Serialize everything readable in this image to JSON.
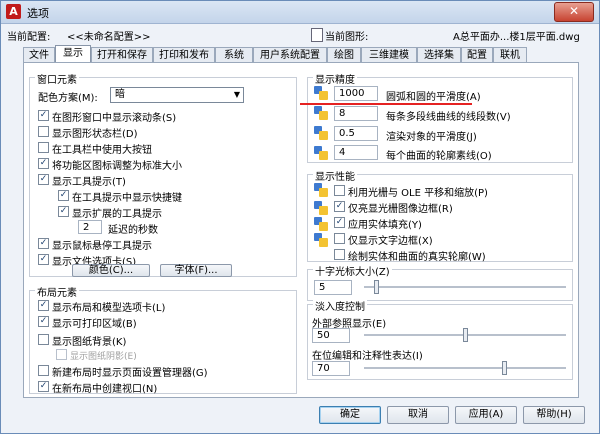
{
  "window": {
    "title": "选项",
    "close": "✕"
  },
  "config": {
    "current_config_label": "当前配置:",
    "current_config_value": "<<未命名配置>>",
    "current_drawing_label": "当前图形:",
    "current_drawing_value": "A总平面办...楼1层平面.dwg"
  },
  "tabs": [
    "文件",
    "显示",
    "打开和保存",
    "打印和发布",
    "系统",
    "用户系统配置",
    "绘图",
    "三维建模",
    "选择集",
    "配置",
    "联机"
  ],
  "active_tab": "显示",
  "window_elements": {
    "title": "窗口元素",
    "color_scheme_label": "配色方案(M):",
    "color_scheme_value": "暗",
    "items": [
      {
        "label": "在图形窗口中显示滚动条(S)",
        "checked": true
      },
      {
        "label": "显示图形状态栏(D)",
        "checked": false
      },
      {
        "label": "在工具栏中使用大按钮",
        "checked": false
      },
      {
        "label": "将功能区图标调整为标准大小",
        "checked": true
      },
      {
        "label": "显示工具提示(T)",
        "checked": true
      },
      {
        "label": "在工具提示中显示快捷键",
        "checked": true
      },
      {
        "label": "显示扩展的工具提示",
        "checked": true
      },
      {
        "label": "延迟的秒数",
        "value": "2"
      },
      {
        "label": "显示鼠标悬停工具提示",
        "checked": true
      },
      {
        "label": "显示文件选项卡(S)",
        "checked": true
      }
    ],
    "colors_button": "颜色(C)...",
    "fonts_button": "字体(F)..."
  },
  "layout_elements": {
    "title": "布局元素",
    "items": [
      {
        "label": "显示布局和模型选项卡(L)",
        "checked": true
      },
      {
        "label": "显示可打印区域(B)",
        "checked": true
      },
      {
        "label": "显示图纸背景(K)",
        "checked": false
      },
      {
        "label": "显示图纸阴影(E)",
        "checked": false,
        "disabled": true
      },
      {
        "label": "新建布局时显示页面设置管理器(G)",
        "checked": false
      },
      {
        "label": "在新布局中创建视口(N)",
        "checked": true
      }
    ]
  },
  "display_resolution": {
    "title": "显示精度",
    "items": [
      {
        "value": "1000",
        "label": "圆弧和圆的平滑度(A)"
      },
      {
        "value": "8",
        "label": "每条多段线曲线的线段数(V)"
      },
      {
        "value": "0.5",
        "label": "渲染对象的平滑度(J)"
      },
      {
        "value": "4",
        "label": "每个曲面的轮廓素线(O)"
      }
    ]
  },
  "display_performance": {
    "title": "显示性能",
    "items": [
      {
        "label": "利用光栅与 OLE 平移和缩放(P)",
        "checked": false
      },
      {
        "label": "仅亮显光栅图像边框(R)",
        "checked": true
      },
      {
        "label": "应用实体填充(Y)",
        "checked": true
      },
      {
        "label": "仅显示文字边框(X)",
        "checked": false
      },
      {
        "label": "绘制实体和曲面的真实轮廓(W)",
        "checked": false
      }
    ]
  },
  "crosshair": {
    "title": "十字光标大小(Z)",
    "value": "5",
    "fraction": 0.05
  },
  "fade": {
    "title": "淡入度控制",
    "xref_label": "外部参照显示(E)",
    "xref_value": "50",
    "xref_fraction": 0.5,
    "inplace_label": "在位编辑和注释性表达(I)",
    "inplace_value": "70",
    "inplace_fraction": 0.7
  },
  "buttons": {
    "ok": "确定",
    "cancel": "取消",
    "apply": "应用(A)",
    "help": "帮助(H)"
  },
  "colors": {
    "accent_red": "#e52222",
    "titlebar": "#c3d4ea"
  }
}
